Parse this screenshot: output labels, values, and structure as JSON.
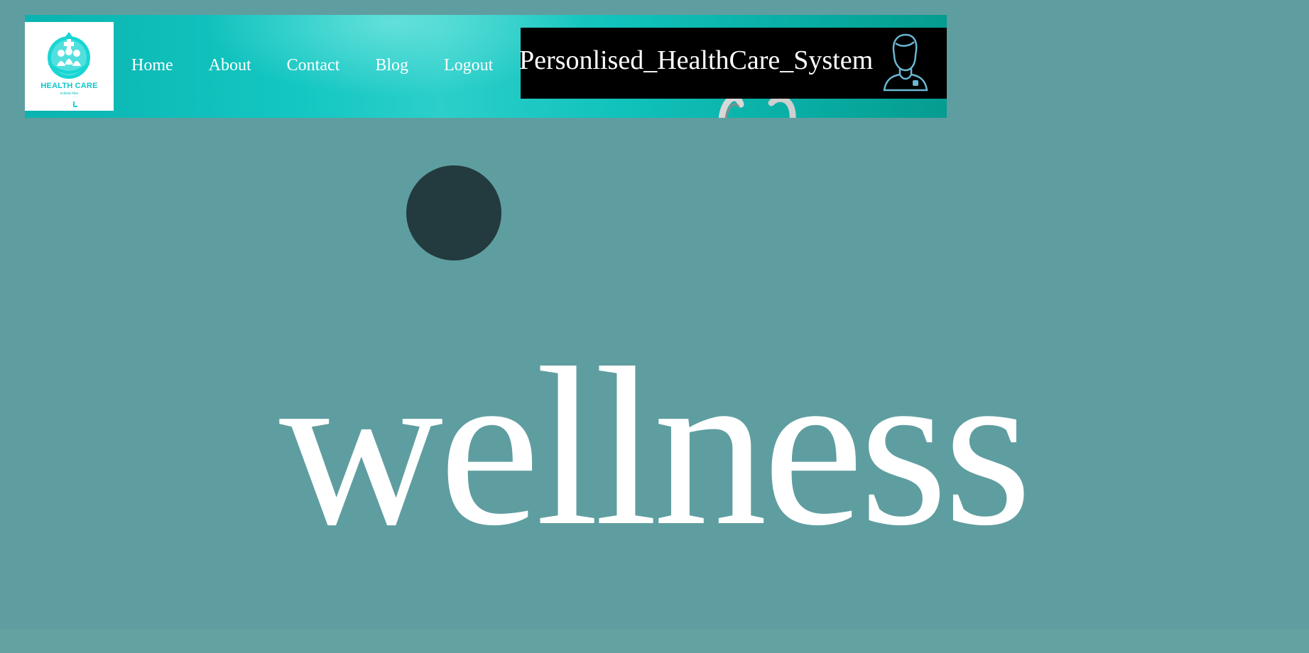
{
  "logo": {
    "title": "HEALTH CARE",
    "subtitle": "ecliwia bleo",
    "icon": "health-care-logo-icon"
  },
  "nav": {
    "items": [
      {
        "label": "Home"
      },
      {
        "label": "About"
      },
      {
        "label": "Contact"
      },
      {
        "label": "Blog"
      },
      {
        "label": "Logout"
      }
    ]
  },
  "header": {
    "site_title": "Personlised_HealthCare_System",
    "avatar_icon": "doctor-avatar-icon"
  },
  "hero": {
    "word": "wellness"
  },
  "colors": {
    "page_background": "#5f9ea0",
    "header_teal": "#14c7c2",
    "title_box": "#000000",
    "circle": "#233b3e",
    "text": "#ffffff",
    "avatar_stroke": "#6ab7d2"
  }
}
